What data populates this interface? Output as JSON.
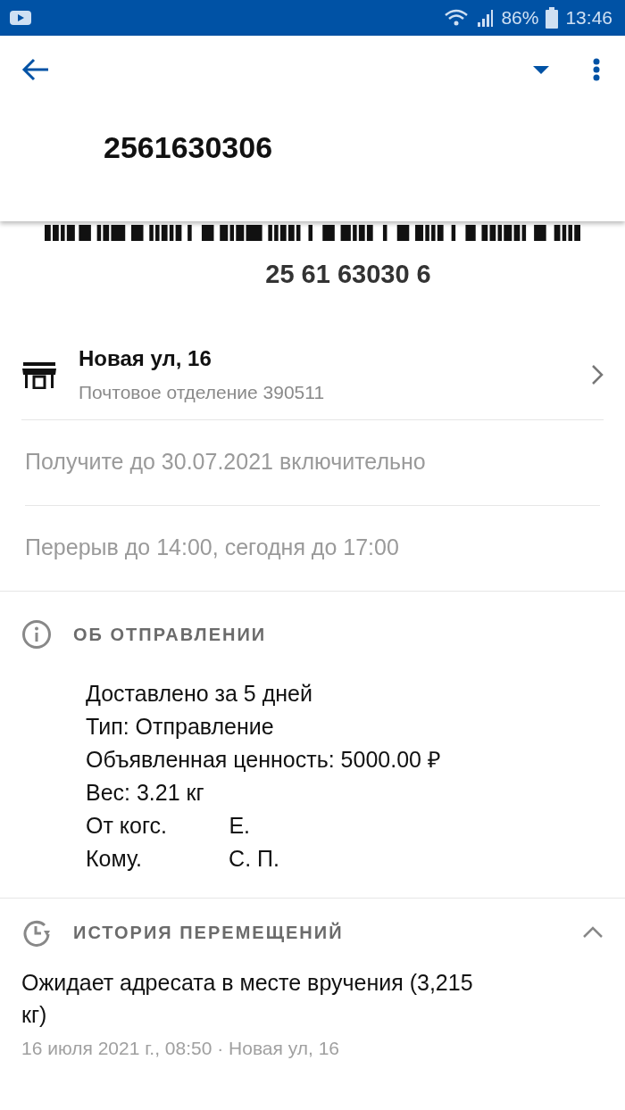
{
  "status_bar": {
    "battery": "86%",
    "time": "13:46"
  },
  "app_bar": {
    "title": "2561630306"
  },
  "barcode": {
    "number": "25 61 63030 6"
  },
  "office": {
    "name": "Новая ул, 16",
    "subtitle": "Почтовое отделение 390511"
  },
  "notices": [
    "Получите до 30.07.2021 включительно",
    "Перерыв до 14:00, сегодня до 17:00"
  ],
  "about": {
    "heading": "ОБ ОТПРАВЛЕНИИ",
    "lines": [
      "Доставлено за 5 дней",
      "Тип: Отправление",
      "Объявленная ценность: 5000.00 ₽",
      "Вес: 3.21 кг",
      "От когс.          Е.",
      "Кому.              С. П."
    ]
  },
  "history": {
    "heading": "ИСТОРИЯ ПЕРЕМЕЩЕНИЙ",
    "expanded": true,
    "events": [
      {
        "title": "Ожидает адресата в месте вручения (3,215 кг)",
        "meta": "16 июля 2021 г., 08:50 · Новая ул, 16"
      }
    ]
  }
}
